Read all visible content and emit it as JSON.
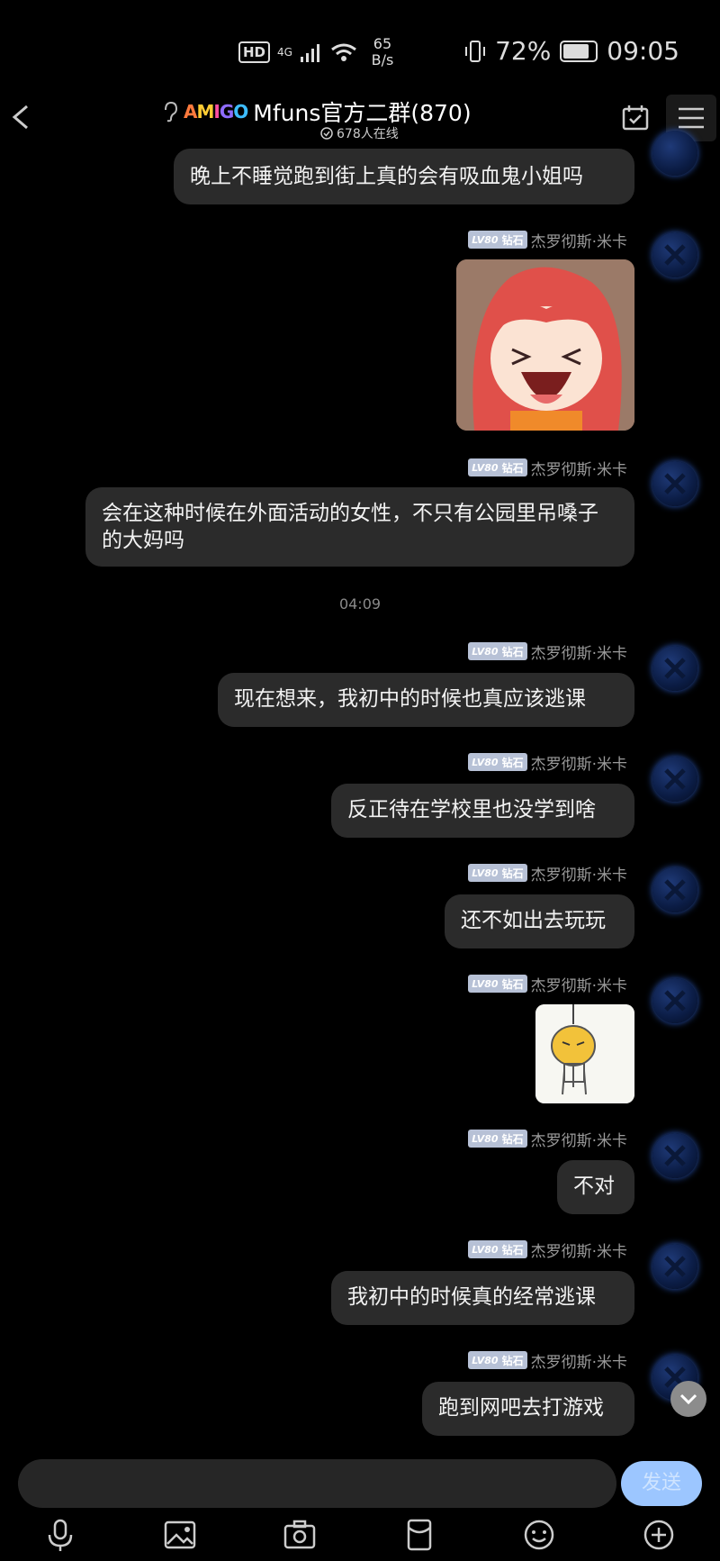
{
  "status_bar": {
    "hd": "HD",
    "network": "4G",
    "speed_value": "65",
    "speed_unit": "B/s",
    "battery": "72%",
    "time": "09:05"
  },
  "header": {
    "logo_text": "AMIGO",
    "group_name": "Mfuns官方二群(870)",
    "online_count": "678人在线"
  },
  "sender": {
    "level": "LV80",
    "rank": "钻石",
    "name": "杰罗彻斯·米卡"
  },
  "messages": [
    {
      "type": "text",
      "text": "晚上不睡觉跑到街上真的会有吸血鬼小姐吗"
    },
    {
      "type": "image",
      "image": "anime-girl-laughing"
    },
    {
      "type": "text",
      "text": "会在这种时候在外面活动的女性，不只有公园里吊嗓子的大妈吗"
    },
    {
      "type": "time",
      "text": "04:09"
    },
    {
      "type": "text",
      "text": "现在想来，我初中的时候也真应该逃课"
    },
    {
      "type": "text",
      "text": "反正待在学校里也没学到啥"
    },
    {
      "type": "text",
      "text": "还不如出去玩玩"
    },
    {
      "type": "image",
      "image": "hanging-sticker"
    },
    {
      "type": "text",
      "text": "不对"
    },
    {
      "type": "text",
      "text": "我初中的时候真的经常逃课"
    },
    {
      "type": "text",
      "text": "跑到网吧去打游戏"
    }
  ],
  "input": {
    "send_label": "发送"
  },
  "toolbar_icons": [
    "microphone-icon",
    "image-icon",
    "camera-icon",
    "red-packet-icon",
    "emoji-icon",
    "plus-icon"
  ],
  "colors": {
    "bubble": "#2b2b2b",
    "send_button": "#9cc6ff",
    "level_badge": "#b7c1d6"
  }
}
